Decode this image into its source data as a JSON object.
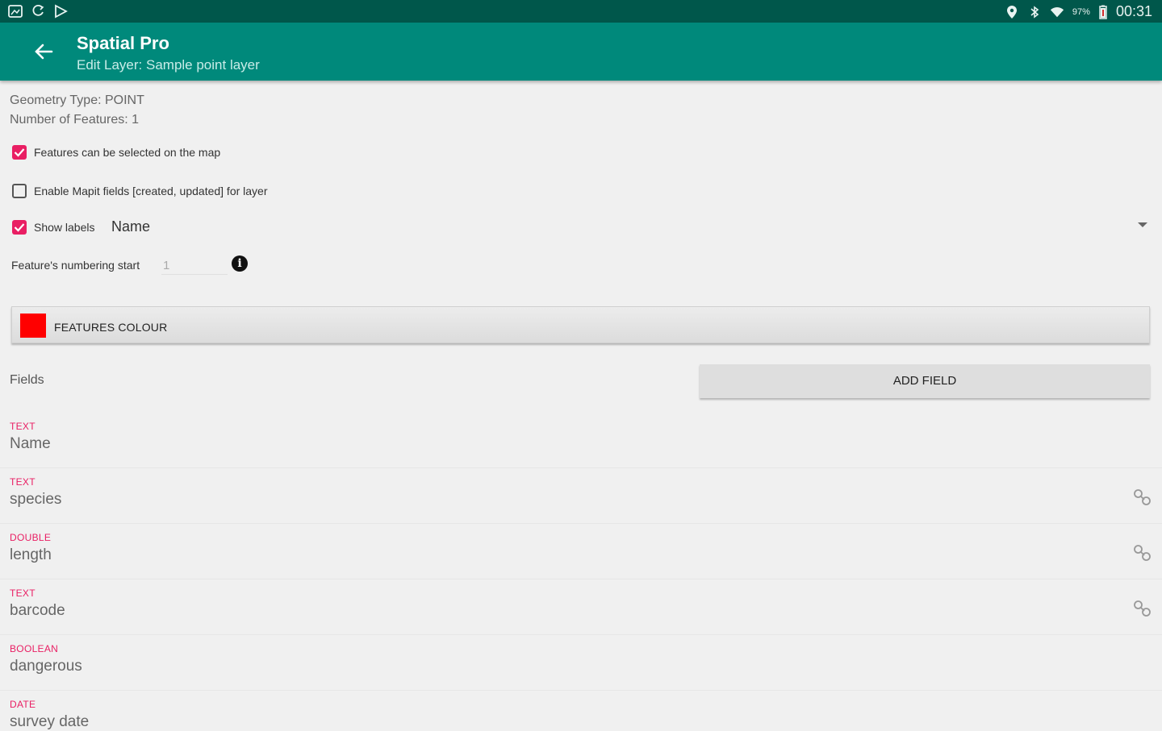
{
  "status_bar": {
    "left_icons": [
      "gallery-icon",
      "sync-icon",
      "play-store-icon"
    ],
    "right_icons": [
      "location-icon",
      "bluetooth-icon",
      "wifi-icon"
    ],
    "battery": "97%",
    "time": "00:31"
  },
  "app_bar": {
    "title": "Spatial Pro",
    "subtitle": "Edit Layer: Sample point layer"
  },
  "layer_info": {
    "geometry_type": "Geometry Type: POINT",
    "feature_count": "Number of Features: 1"
  },
  "options": {
    "selectable": {
      "label": "Features can be selected on the map",
      "checked": true
    },
    "mapit_fields": {
      "label": "Enable Mapit fields [created, updated] for layer",
      "checked": false
    },
    "show_labels": {
      "label": "Show labels",
      "checked": true,
      "selected_field": "Name"
    },
    "numbering": {
      "label": "Feature's numbering start",
      "value": "1"
    }
  },
  "colour_button": {
    "label": "FEATURES COLOUR",
    "colour": "#ff0000"
  },
  "fields_section": {
    "title": "Fields",
    "add_button": "ADD FIELD"
  },
  "fields": [
    {
      "type": "TEXT",
      "name": "Name",
      "linked": false
    },
    {
      "type": "TEXT",
      "name": "species",
      "linked": true
    },
    {
      "type": "DOUBLE",
      "name": "length",
      "linked": true
    },
    {
      "type": "TEXT",
      "name": "barcode",
      "linked": true
    },
    {
      "type": "BOOLEAN",
      "name": "dangerous",
      "linked": false
    },
    {
      "type": "DATE",
      "name": "survey date",
      "linked": false
    }
  ],
  "colors": {
    "accent": "#e91e63",
    "primary": "#00897b",
    "primary_dark": "#00574b"
  }
}
